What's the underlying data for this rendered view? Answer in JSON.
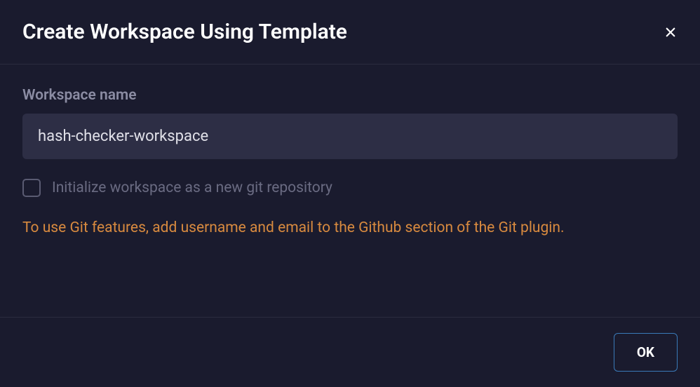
{
  "dialog": {
    "title": "Create Workspace Using Template",
    "workspace_name_label": "Workspace name",
    "workspace_name_value": "hash-checker-workspace",
    "git_init_checkbox_label": "Initialize workspace as a new git repository",
    "git_init_checked": false,
    "warning_message": "To use Git features, add username and email to the Github section of the Git plugin.",
    "ok_button_label": "OK"
  }
}
